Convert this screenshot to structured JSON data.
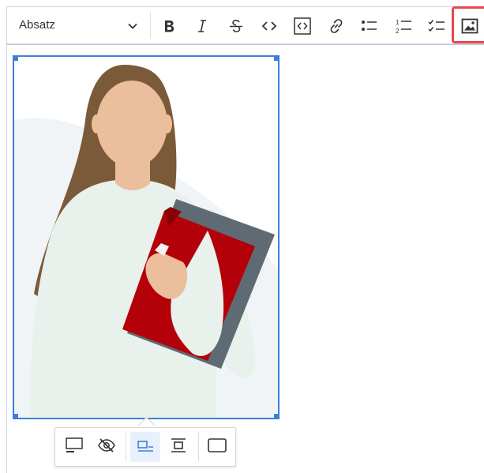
{
  "toolbar": {
    "paragraph_select": {
      "label": "Absatz",
      "icon": "chevron-down-icon"
    },
    "buttons": [
      {
        "name": "bold",
        "icon": "bold-icon"
      },
      {
        "name": "italic",
        "icon": "italic-icon"
      },
      {
        "name": "strikethrough",
        "icon": "strikethrough-icon"
      },
      {
        "name": "code",
        "icon": "code-icon"
      },
      {
        "name": "code-block",
        "icon": "code-block-icon"
      },
      {
        "name": "link",
        "icon": "link-icon"
      },
      {
        "name": "bulleted-list",
        "icon": "bulleted-list-icon"
      },
      {
        "name": "numbered-list",
        "icon": "numbered-list-icon"
      },
      {
        "name": "todo-list",
        "icon": "todo-list-icon"
      },
      {
        "name": "insert-image",
        "icon": "image-icon",
        "highlighted": true
      }
    ],
    "highlight_color": "#e5484d"
  },
  "editor": {
    "selection_color": "#3b7fdc",
    "image": {
      "description": "illustration",
      "selected": true
    }
  },
  "image_toolbar": {
    "buttons": [
      {
        "name": "toggle-caption",
        "icon": "caption-icon"
      },
      {
        "name": "hide-alt",
        "icon": "eye-slash-icon"
      },
      {
        "name": "align-left",
        "icon": "align-left-icon",
        "active": true
      },
      {
        "name": "align-center",
        "icon": "align-center-icon"
      },
      {
        "name": "resize",
        "icon": "frame-icon"
      }
    ]
  }
}
